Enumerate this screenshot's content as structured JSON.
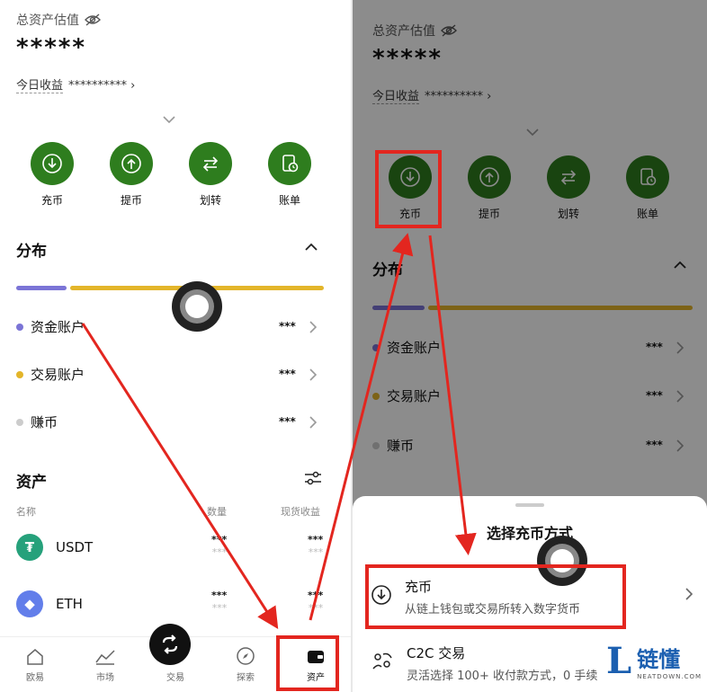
{
  "total_label": "总资产估值",
  "total_value": "*****",
  "today_label": "今日收益",
  "today_value": "********** ›",
  "actions": [
    {
      "label": "充币",
      "icon": "download-icon"
    },
    {
      "label": "提币",
      "icon": "upload-icon"
    },
    {
      "label": "划转",
      "icon": "transfer-icon"
    },
    {
      "label": "账单",
      "icon": "bill-icon"
    }
  ],
  "distribution": {
    "title": "分布",
    "accounts": [
      {
        "name": "资金账户",
        "value": "***",
        "color": "#7b74d6"
      },
      {
        "name": "交易账户",
        "value": "***",
        "color": "#e3b52a"
      },
      {
        "name": "赚币",
        "value": "***",
        "color": "#cccccc"
      }
    ]
  },
  "assets": {
    "title": "资产",
    "col_name": "名称",
    "col_qty": "数量",
    "col_profit": "现货收益",
    "coins": [
      {
        "symbol": "USDT",
        "qty": "***",
        "qty_sub": "***",
        "profit": "***",
        "profit_sub": "***",
        "color": "#26a17b"
      },
      {
        "symbol": "ETH",
        "qty": "***",
        "qty_sub": "***",
        "profit": "***",
        "profit_sub": "***",
        "color": "#627eea"
      }
    ]
  },
  "tabs": [
    {
      "label": "欧易",
      "icon": "home-icon"
    },
    {
      "label": "市场",
      "icon": "chart-icon"
    },
    {
      "label": "交易",
      "icon": "swap-icon"
    },
    {
      "label": "探索",
      "icon": "compass-icon"
    },
    {
      "label": "资产",
      "icon": "wallet-icon"
    }
  ],
  "sheet": {
    "title": "选择充币方式",
    "options": [
      {
        "title": "充币",
        "desc": "从链上钱包或交易所转入数字货币",
        "icon": "download-icon"
      },
      {
        "title": "C2C 交易",
        "desc": "灵活选择 100+ 收付款方式，0 手续",
        "icon": "c2c-icon"
      }
    ]
  },
  "watermark": {
    "cn": "链懂",
    "en": "NEATDOWN.COM",
    "letter": "L"
  },
  "colors": {
    "accent": "#2e7d1e",
    "highlight": "#e3261f"
  }
}
